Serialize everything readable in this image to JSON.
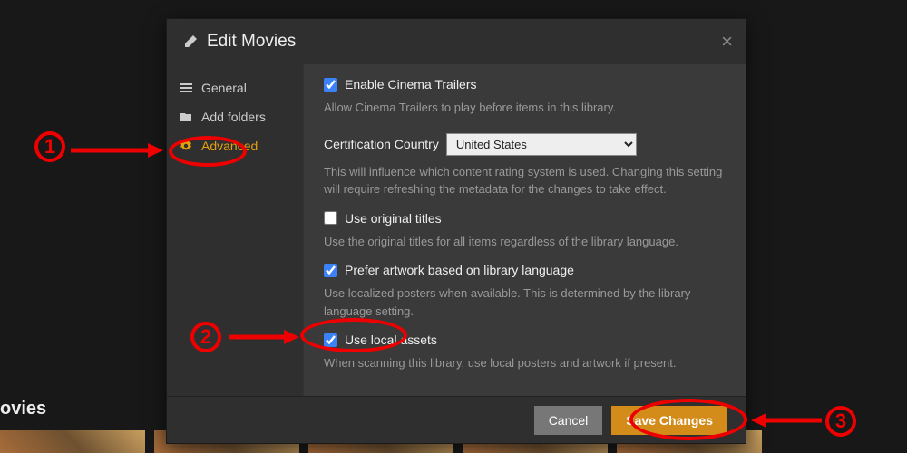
{
  "bg": {
    "section_label": "ovies"
  },
  "modal": {
    "title": "Edit Movies",
    "close_label": "×"
  },
  "sidebar": {
    "items": [
      {
        "label": "General"
      },
      {
        "label": "Add folders"
      },
      {
        "label": "Advanced"
      }
    ]
  },
  "settings": {
    "enable_trailers": {
      "label": "Enable Cinema Trailers",
      "checked": true,
      "help": "Allow Cinema Trailers to play before items in this library."
    },
    "cert_country": {
      "label": "Certification Country",
      "value": "United States",
      "options": [
        "United States"
      ],
      "help": "This will influence which content rating system is used. Changing this setting will require refreshing the metadata for the changes to take effect."
    },
    "original_titles": {
      "label": "Use original titles",
      "checked": false,
      "help": "Use the original titles for all items regardless of the library language."
    },
    "prefer_artwork": {
      "label": "Prefer artwork based on library language",
      "checked": true,
      "help": "Use localized posters when available. This is determined by the library language setting."
    },
    "local_assets": {
      "label": "Use local assets",
      "checked": true,
      "help": "When scanning this library, use local posters and artwork if present."
    }
  },
  "footer": {
    "cancel": "Cancel",
    "save": "Save Changes"
  },
  "annotations": {
    "n1": "1",
    "n2": "2",
    "n3": "3"
  }
}
